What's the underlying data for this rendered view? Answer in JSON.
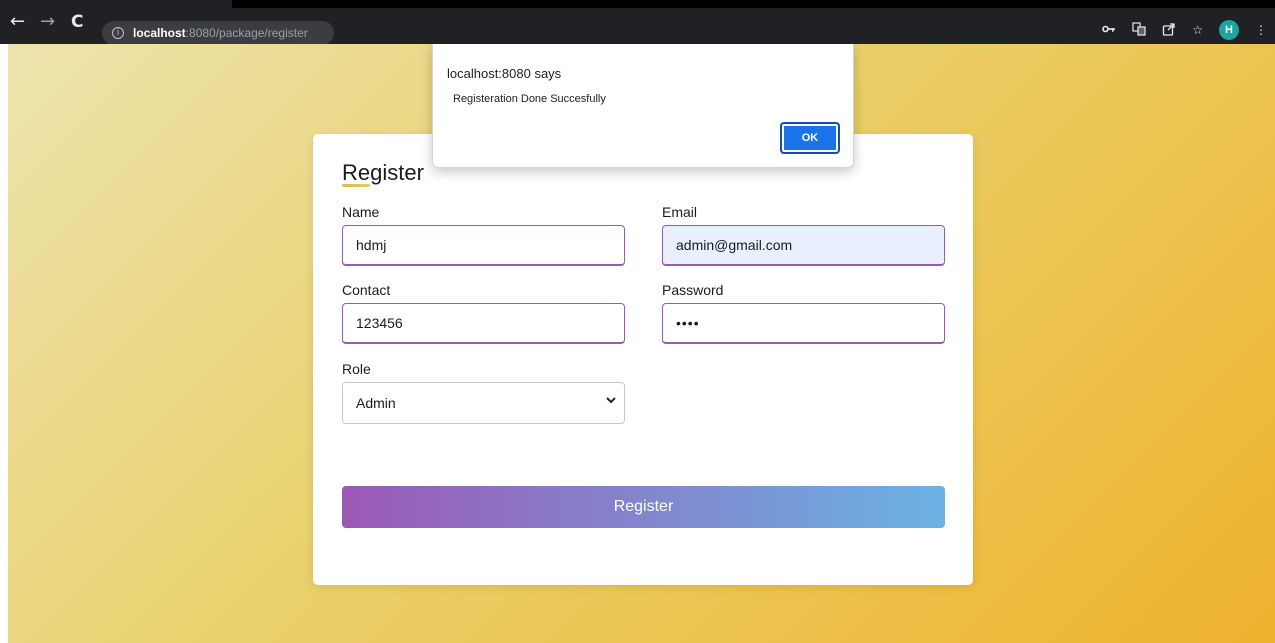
{
  "browser": {
    "back_icon": "arrow-left-icon",
    "forward_icon": "arrow-right-icon",
    "reload_icon": "reload-icon",
    "url_host": "localhost",
    "url_rest": ":8080/package/register",
    "icons": [
      "key-icon",
      "translate-icon",
      "share-icon",
      "star-icon",
      "profile-avatar",
      "more-icon"
    ],
    "profile_initial": "H",
    "profile_color": "#1aa5a0"
  },
  "form": {
    "title": "Register",
    "name_label": "Name",
    "name_value": "hdmj",
    "email_label": "Email",
    "email_value": "admin@gmail.com",
    "contact_label": "Contact",
    "contact_value": "123456",
    "password_label": "Password",
    "password_value": "••••",
    "role_label": "Role",
    "role_value": "Admin",
    "submit_label": "Register",
    "accent_color": "#9b59b6",
    "button_gradient": [
      "#9b59b6",
      "#6bb2e4"
    ]
  },
  "dialog": {
    "title": "localhost:8080 says",
    "message": "Registeration Done Succesfully",
    "ok_label": "OK",
    "ok_color": "#1a73e8"
  }
}
